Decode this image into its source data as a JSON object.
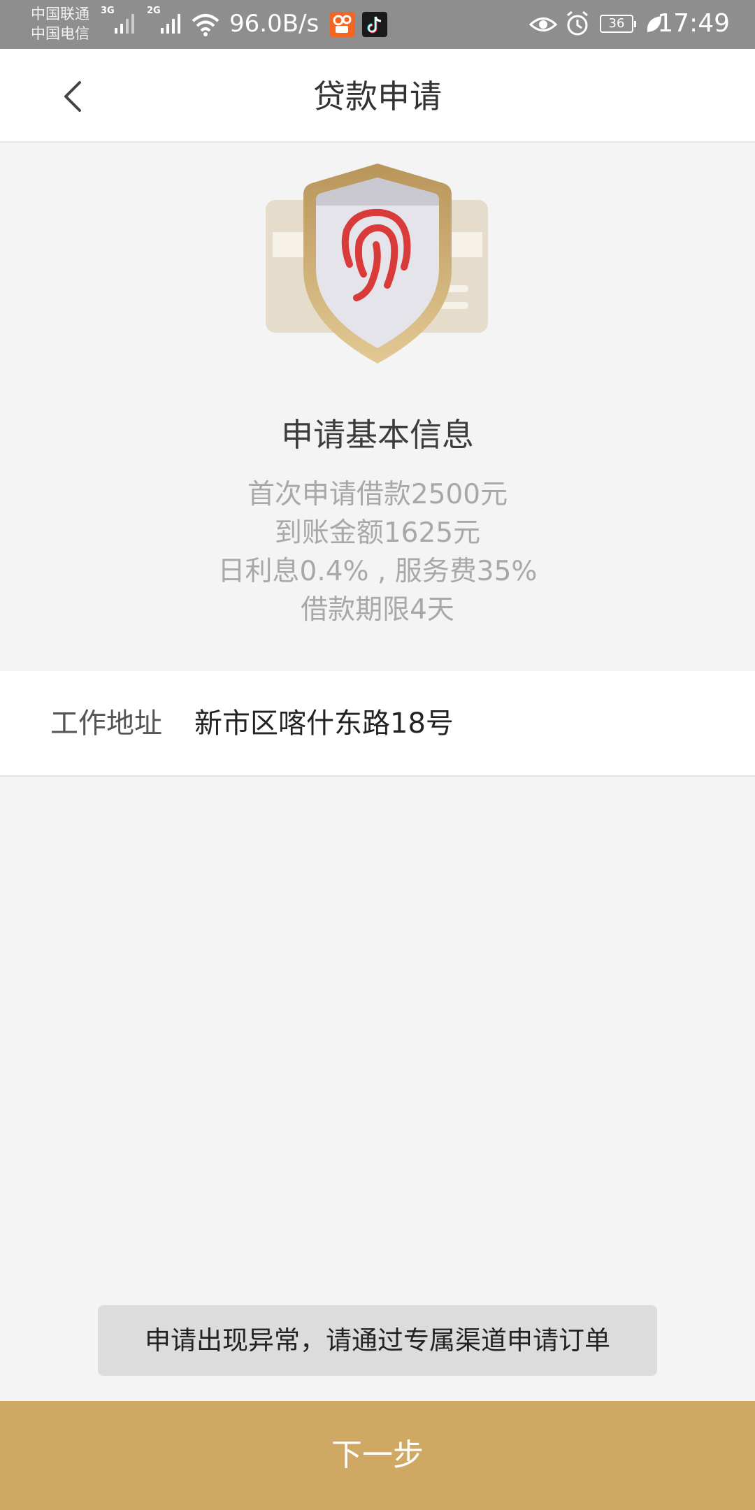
{
  "status_bar": {
    "carrier_1": "中国联通",
    "carrier_2": "中国电信",
    "net_1": "3G",
    "net_2": "2G",
    "speed": "96.0B/s",
    "battery": "36",
    "time": "17:49",
    "icons": [
      "signal-icon",
      "wifi-icon",
      "kuaishou-app-icon",
      "tiktok-app-icon",
      "eye-icon",
      "alarm-icon",
      "battery-icon",
      "leaf-icon"
    ]
  },
  "header": {
    "title": "贷款申请",
    "back_icon": "chevron-left-icon"
  },
  "hero": {
    "illustration_icon": "fingerprint-shield-icon",
    "title": "申请基本信息",
    "lines": [
      "首次申请借款2500元",
      "到账金额1625元",
      "日利息0.4% , 服务费35%",
      "借款期限4天"
    ]
  },
  "form": {
    "address_label": "工作地址",
    "address_value": "新市区喀什东路18号"
  },
  "toast": {
    "message": "申请出现异常，请通过专属渠道申请订单"
  },
  "actions": {
    "next_label": "下一步"
  },
  "colors": {
    "status_bar": "#8e8e8e",
    "accent": "#cfa963",
    "fingerprint": "#d93a3a",
    "background": "#f4f4f4"
  }
}
